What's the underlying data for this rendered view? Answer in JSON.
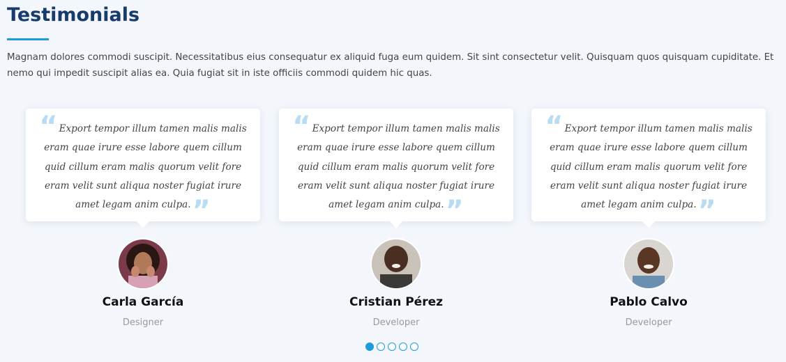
{
  "section": {
    "title": "Testimonials",
    "intro": "Magnam dolores commodi suscipit. Necessitatibus eius consequatur ex aliquid fuga eum quidem. Sit sint consectetur velit. Quisquam quos quisquam cupiditate. Et nemo qui impedit suscipit alias ea. Quia fugiat sit in iste officiis commodi quidem hic quas."
  },
  "testimonials": [
    {
      "quote": "Export tempor illum tamen malis malis eram quae irure esse labore quem cillum quid cillum eram malis quorum velit fore eram velit sunt aliqua noster fugiat irure amet legam anim culpa.",
      "name": "Carla García",
      "role": "Designer"
    },
    {
      "quote": "Export tempor illum tamen malis malis eram quae irure esse labore quem cillum quid cillum eram malis quorum velit fore eram velit sunt aliqua noster fugiat irure amet legam anim culpa.",
      "name": "Cristian Pérez",
      "role": "Developer"
    },
    {
      "quote": "Export tempor illum tamen malis malis eram quae irure esse labore quem cillum quid cillum eram malis quorum velit fore eram velit sunt aliqua noster fugiat irure amet legam anim culpa.",
      "name": "Pablo Calvo",
      "role": "Developer"
    }
  ],
  "carousel": {
    "total_pages": 5,
    "active_page": 1
  },
  "icons": {
    "quote_open": "quote-left-icon",
    "quote_close": "quote-right-icon"
  },
  "colors": {
    "title": "#173b6c",
    "accent": "#1d9bdb",
    "quote_icon": "#b7dcf3",
    "background": "#f3f6fb"
  }
}
